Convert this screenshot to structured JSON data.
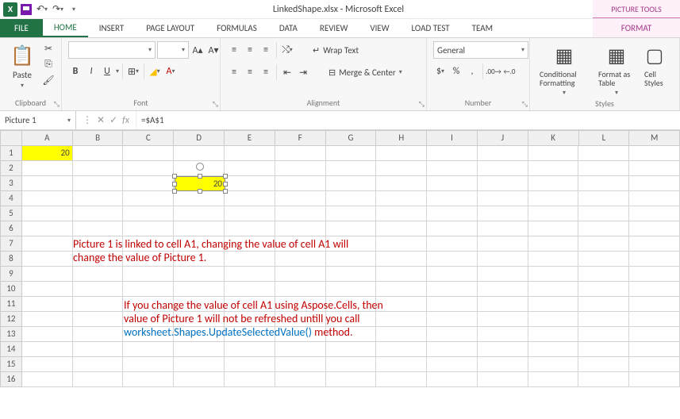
{
  "title": "LinkedShape.xlsx - Microsoft Excel",
  "contextual_tab_group": "PICTURE TOOLS",
  "tabs": {
    "file": "FILE",
    "home": "HOME",
    "insert": "INSERT",
    "page_layout": "PAGE LAYOUT",
    "formulas": "FORMULAS",
    "data": "DATA",
    "review": "REVIEW",
    "view": "VIEW",
    "load_test": "LOAD TEST",
    "team": "TEAM",
    "format": "FORMAT"
  },
  "ribbon": {
    "clipboard": {
      "paste": "Paste",
      "label": "Clipboard"
    },
    "font": {
      "label": "Font",
      "family": "",
      "size": "",
      "bold": "B",
      "italic": "I",
      "underline": "U"
    },
    "alignment": {
      "label": "Alignment",
      "wrap": "Wrap Text",
      "merge": "Merge & Center"
    },
    "number": {
      "label": "Number",
      "format": "General"
    },
    "styles": {
      "label": "Styles",
      "cond": "Conditional Formatting",
      "table": "Format as Table",
      "cell": "Cell Styles"
    }
  },
  "name_box": "Picture 1",
  "formula": "=$A$1",
  "columns": [
    "A",
    "B",
    "C",
    "D",
    "E",
    "F",
    "G",
    "H",
    "I",
    "J",
    "K",
    "L",
    "M"
  ],
  "rows": [
    "1",
    "2",
    "3",
    "4",
    "5",
    "6",
    "7",
    "8",
    "9",
    "10",
    "11",
    "12",
    "13",
    "14",
    "15",
    "16"
  ],
  "cells": {
    "A1": "20"
  },
  "picture_value": "20",
  "note1a": "Picture 1 is linked to cell A1, changing the value of cell A1 will",
  "note1b": "change the value of Picture 1.",
  "note2a": "If you change the value of cell A1 using Aspose.Cells, then",
  "note2b": "value of Picture 1 will not be refreshed untill you call",
  "note2c_blue": "worksheet.Shapes.UpdateSelectedValue()",
  "note2c_red": " method."
}
